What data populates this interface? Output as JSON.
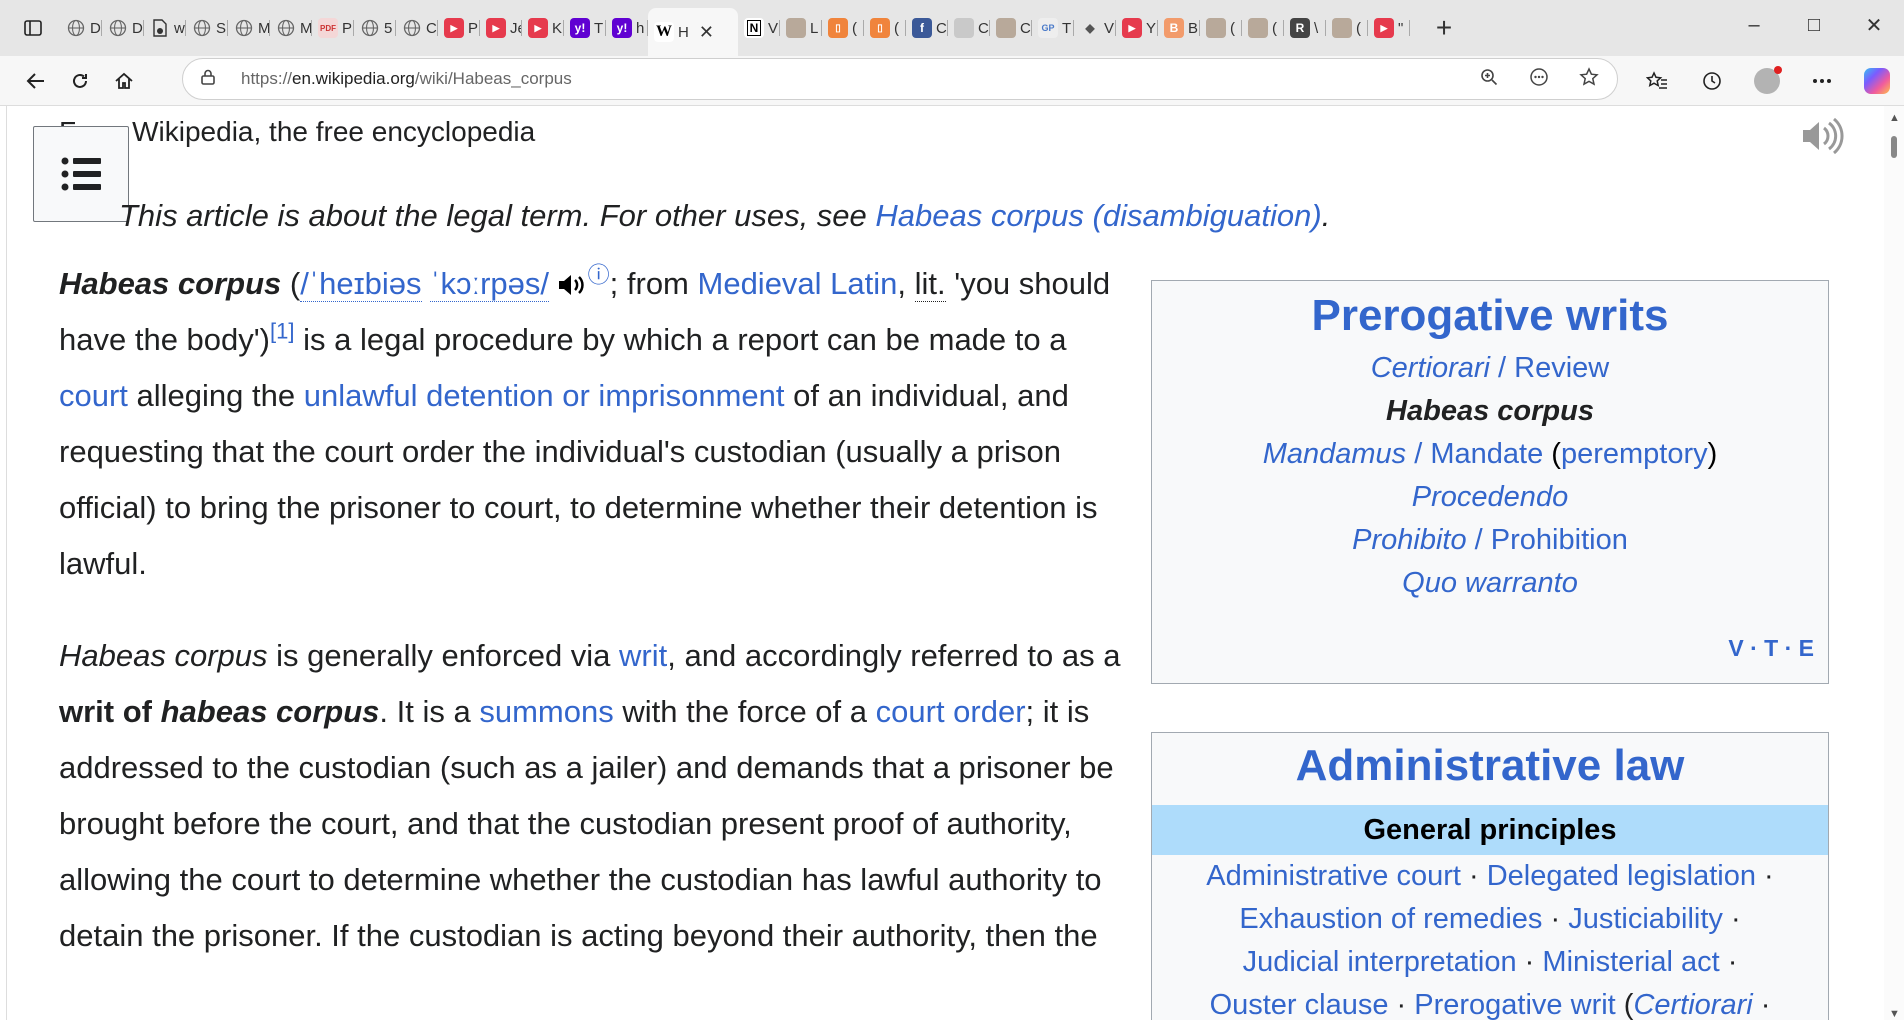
{
  "browser": {
    "tabs": [
      {
        "letter": "D",
        "icon": "globe-icon"
      },
      {
        "letter": "D",
        "icon": "globe-icon"
      },
      {
        "letter": "w",
        "icon": "doc-icon"
      },
      {
        "letter": "S",
        "icon": "globe-icon"
      },
      {
        "letter": "M",
        "icon": "globe-icon"
      },
      {
        "letter": "M",
        "icon": "globe-icon"
      },
      {
        "letter": "P",
        "icon": "pdf-icon"
      },
      {
        "letter": "5",
        "icon": "globe-icon"
      },
      {
        "letter": "C",
        "icon": "globe-icon"
      },
      {
        "letter": "P",
        "icon": "youtube-icon"
      },
      {
        "letter": "Je",
        "icon": "youtube-icon"
      },
      {
        "letter": "K",
        "icon": "youtube-icon"
      },
      {
        "letter": "T",
        "icon": "yahoo-icon"
      },
      {
        "letter": "h",
        "icon": "yahoo-icon"
      }
    ],
    "active_tab": {
      "letter": "H",
      "close": "✕"
    },
    "tabs_after": [
      {
        "letter": "V",
        "icon": "notion-icon"
      },
      {
        "letter": "L",
        "icon": "image-icon"
      },
      {
        "letter": "(",
        "icon": "orange-icon"
      },
      {
        "letter": "(",
        "icon": "orange-icon"
      },
      {
        "letter": "C",
        "icon": "f-icon"
      },
      {
        "letter": "C",
        "icon": "seal-icon"
      },
      {
        "letter": "C",
        "icon": "image-icon"
      },
      {
        "letter": "T",
        "icon": "gp-icon"
      },
      {
        "letter": "V",
        "icon": "diamond-icon"
      },
      {
        "letter": "Y",
        "icon": "youtube-icon"
      },
      {
        "letter": "B",
        "icon": "b-icon"
      },
      {
        "letter": "(",
        "icon": "image-icon"
      },
      {
        "letter": "(",
        "icon": "image-icon"
      },
      {
        "letter": "\\",
        "icon": "r-icon"
      },
      {
        "letter": "(",
        "icon": "image-icon"
      },
      {
        "letter": "\"",
        "icon": "youtube-icon"
      }
    ],
    "url_prefix": "https://",
    "url_domain": "en.wikipedia.org",
    "url_path": "/wiki/Habeas_corpus"
  },
  "article": {
    "from_line": "From Wikipedia, the free encyclopedia",
    "hatnote_text": "This article is about the legal term. For other uses, see ",
    "hatnote_link": "Habeas corpus (disambiguation)",
    "hatnote_end": ".",
    "p1": {
      "term": "Habeas corpus",
      "open_paren": " (",
      "ipa1": "/ˈheɪbiəs",
      "ipa2": "ˈkɔːrpəs/",
      "info": "ⓘ",
      "from": "; from ",
      "latin_link": "Medieval Latin",
      "comma": ",",
      "lit": "lit.",
      "quote": " 'you should have the body')",
      "ref": "[1]",
      "t1": " is a legal procedure by which a report can be made to a ",
      "court_link": "court",
      "t2": " alleging the ",
      "unlawful_link": "unlawful detention or imprisonment",
      "t3": " of an individual, and requesting that the court order the individual's custodian (usually a prison official) to bring the prisoner to court, to determine whether their detention is lawful."
    },
    "p2": {
      "term": "Habeas corpus",
      "t1": " is generally enforced via ",
      "writ_link": "writ",
      "t2": ", and accordingly referred to as a ",
      "bold1": "writ of ",
      "bold2": "habeas corpus",
      "t3": ". It is a ",
      "summons_link": "summons",
      "t4": " with the force of a ",
      "order_link": "court order",
      "t5": "; it is addressed to the custodian (such as a jailer) and demands that a prisoner be brought before the court, and that the custodian present proof of authority, allowing the court to determine whether the custodian has lawful authority to detain the prisoner. If the custodian is acting beyond their authority, then the"
    }
  },
  "infobox_writs": {
    "title": "Prerogative writs",
    "certiorari": "Certiorari",
    "review": "Review",
    "habeas": "Habeas corpus",
    "mandamus": "Mandamus",
    "mandate": "Mandate",
    "peremptory": "peremptory",
    "procedendo": "Procedendo",
    "prohibito": "Prohibito",
    "prohibition": "Prohibition",
    "quo": "Quo warranto",
    "slash": " / ",
    "v": "V",
    "t": "T",
    "e": "E"
  },
  "infobox_admin": {
    "title": "Administrative law",
    "subheader": "General principles",
    "links": [
      "Administrative court",
      "Delegated legislation",
      "Exhaustion of remedies",
      "Justiciability",
      "Judicial interpretation",
      "Ministerial act",
      "Ouster clause",
      "Prerogative writ",
      "Certiorari"
    ]
  },
  "colors": {
    "link": "#3366cc",
    "text": "#202122",
    "infobox_bg": "#f8f9fa",
    "subheader_bg": "#aedcfb"
  }
}
